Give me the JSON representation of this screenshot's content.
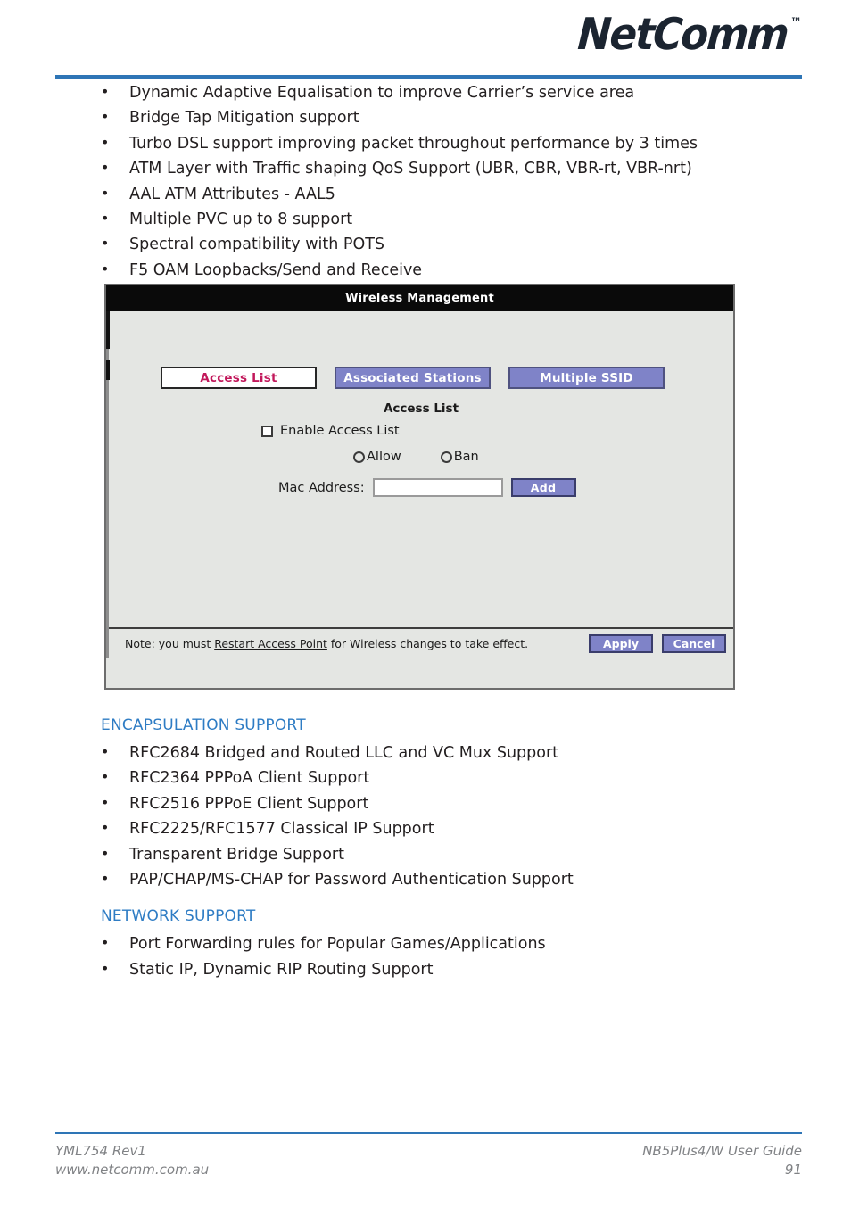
{
  "header": {
    "logo_text": "NetComm",
    "logo_tm": "™"
  },
  "features": {
    "items": [
      "Dynamic Adaptive Equalisation to improve Carrier’s service area",
      "Bridge Tap Mitigation support",
      "Turbo DSL support improving packet throughout performance by 3 times",
      "ATM Layer with Traffic shaping QoS Support (UBR, CBR, VBR-rt, VBR-nrt)",
      "AAL ATM Attributes - AAL5",
      "Multiple PVC up to 8 support",
      "Spectral compatibility with POTS",
      "F5 OAM Loopbacks/Send and Receive"
    ]
  },
  "screenshot": {
    "title": "Wireless Management",
    "tabs": [
      {
        "label": "Access List",
        "active": true
      },
      {
        "label": "Associated Stations",
        "active": false
      },
      {
        "label": "Multiple SSID",
        "active": false
      }
    ],
    "subtitle": "Access List",
    "enable_checkbox_label": "Enable Access List",
    "enable_checkbox_checked": false,
    "radios": [
      {
        "label": "Allow",
        "selected": false
      },
      {
        "label": "Ban",
        "selected": false
      }
    ],
    "mac_label": "Mac Address:",
    "mac_value": "",
    "add_button": "Add",
    "note_prefix": "Note: you must ",
    "note_link": "Restart Access Point",
    "note_suffix": " for Wireless changes to take effect.",
    "apply_button": "Apply",
    "cancel_button": "Cancel",
    "colors": {
      "tab_active_bg": "#ffffff",
      "tab_active_text": "#c2185b",
      "tab_inactive_bg": "#7f83c8",
      "tab_inactive_text": "#ffffff",
      "titlebar_bg": "#0a0a0a",
      "panel_bg": "#e4e6e3"
    }
  },
  "encapsulation": {
    "heading": "ENCAPSULATION SUPPORT",
    "items": [
      "RFC2684 Bridged and Routed LLC and VC Mux Support",
      "RFC2364 PPPoA Client Support",
      "RFC2516 PPPoE Client Support",
      "RFC2225/RFC1577 Classical IP Support",
      "Transparent Bridge Support",
      "PAP/CHAP/MS-CHAP for Password Authentication Support"
    ]
  },
  "network": {
    "heading": "NETWORK SUPPORT",
    "items": [
      "Port Forwarding rules for Popular Games/Applications",
      "Static IP, Dynamic RIP Routing Support"
    ]
  },
  "footer": {
    "doc_code": "YML754 Rev1",
    "website": "www.netcomm.com.au",
    "guide_title": "NB5Plus4/W User Guide",
    "page_number": "91"
  },
  "theme": {
    "accent_blue": "#2e75b6",
    "heading_blue": "#2e7cc4",
    "body_text": "#231f20",
    "footer_gray": "#808285"
  }
}
